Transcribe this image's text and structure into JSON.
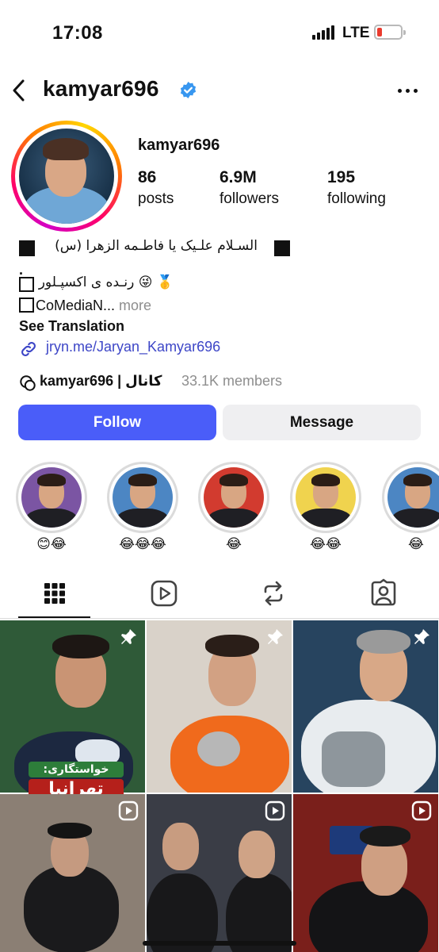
{
  "status_bar": {
    "time": "17:08",
    "network": "LTE",
    "battery_color": "#ea3b2e"
  },
  "header": {
    "username": "kamyar696",
    "back_icon": "chevron-left-icon",
    "verified_icon": "verified-badge-icon",
    "more_icon": "more-horizontal-icon"
  },
  "profile": {
    "name": "kamyar696",
    "stats": [
      {
        "value": "86",
        "label": "posts"
      },
      {
        "value": "6.9M",
        "label": "followers"
      },
      {
        "value": "195",
        "label": "following"
      }
    ]
  },
  "bio": {
    "line1": "السـلام علـیک یا فاطـمه الزهرا (س)",
    "line2": ".",
    "line3": "🥇 😜 رنـده ی اکسپـلور",
    "line4_text": "CoMediaN...",
    "line4_more": " more",
    "see_translation": "See Translation",
    "link": "jryn.me/Jaryan_Kamyar696"
  },
  "channel": {
    "name": "kamyar696 | کانال",
    "members": "33.1K members"
  },
  "buttons": {
    "follow": "Follow",
    "message": "Message"
  },
  "highlights": [
    {
      "label": "😊😂",
      "bg": "#7b55a3"
    },
    {
      "label": "😂😂😂",
      "bg": "#4c86c3"
    },
    {
      "label": "😂",
      "bg": "#d23b2f"
    },
    {
      "label": "😂😂",
      "bg": "#f0d34e"
    },
    {
      "label": "😂",
      "bg": "#4c86c3"
    }
  ],
  "tabs": [
    "grid-icon",
    "reels-icon",
    "reposts-icon",
    "tagged-icon"
  ],
  "grid": {
    "caption_line1": "خواستگاری:",
    "caption_line2": "تهرانیا",
    "tiles": [
      {
        "badge": "pin-icon",
        "bg": "#2f5a38"
      },
      {
        "badge": "pin-icon",
        "bg": "#d9d2c9"
      },
      {
        "badge": "pin-icon",
        "bg": "#27445f"
      },
      {
        "badge": "reel-icon",
        "bg": "#8b7f74"
      },
      {
        "badge": "reel-icon",
        "bg": "#3a3d46"
      },
      {
        "badge": "reel-icon",
        "bg": "#7a1f1b"
      }
    ]
  }
}
